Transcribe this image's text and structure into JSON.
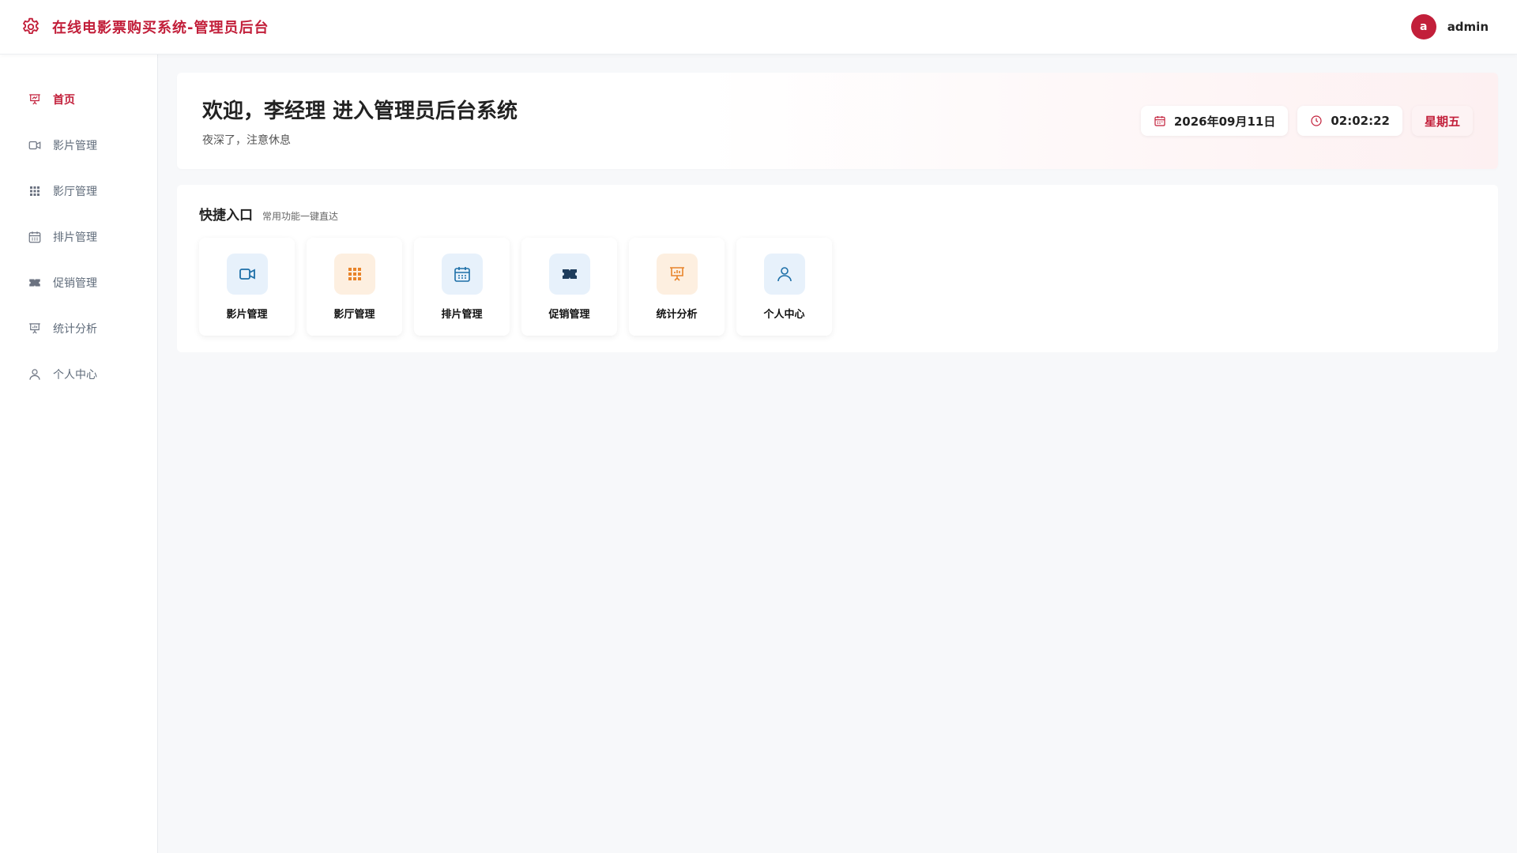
{
  "app": {
    "title": "在线电影票购买系统-管理员后台",
    "icon": "gear-icon",
    "accent": "#c21f3a"
  },
  "user": {
    "avatar_letter": "a",
    "name": "admin"
  },
  "sidebar": {
    "items": [
      {
        "label": "首页",
        "icon": "presentation-chart-icon",
        "active": true
      },
      {
        "label": "影片管理",
        "icon": "video-camera-icon",
        "active": false
      },
      {
        "label": "影厅管理",
        "icon": "grid-icon",
        "active": false
      },
      {
        "label": "排片管理",
        "icon": "calendar-icon",
        "active": false
      },
      {
        "label": "促销管理",
        "icon": "ticket-icon",
        "active": false
      },
      {
        "label": "统计分析",
        "icon": "presentation-chart-icon",
        "active": false
      },
      {
        "label": "个人中心",
        "icon": "user-icon",
        "active": false
      }
    ]
  },
  "welcome": {
    "title": "欢迎，李经理 进入管理员后台系统",
    "subtitle": "夜深了，注意休息",
    "date": "2026年09月11日",
    "time": "02:02:22",
    "weekday": "星期五"
  },
  "quick": {
    "title": "快捷入口",
    "subtitle": "常用功能一键直达",
    "cards": [
      {
        "label": "影片管理",
        "icon": "video-camera-icon",
        "tone": "blue"
      },
      {
        "label": "影厅管理",
        "icon": "grid-icon",
        "tone": "orange"
      },
      {
        "label": "排片管理",
        "icon": "calendar-icon",
        "tone": "blue"
      },
      {
        "label": "促销管理",
        "icon": "ticket-icon",
        "tone": "navy"
      },
      {
        "label": "统计分析",
        "icon": "presentation-chart-icon",
        "tone": "orange"
      },
      {
        "label": "个人中心",
        "icon": "user-icon",
        "tone": "blue"
      }
    ]
  }
}
